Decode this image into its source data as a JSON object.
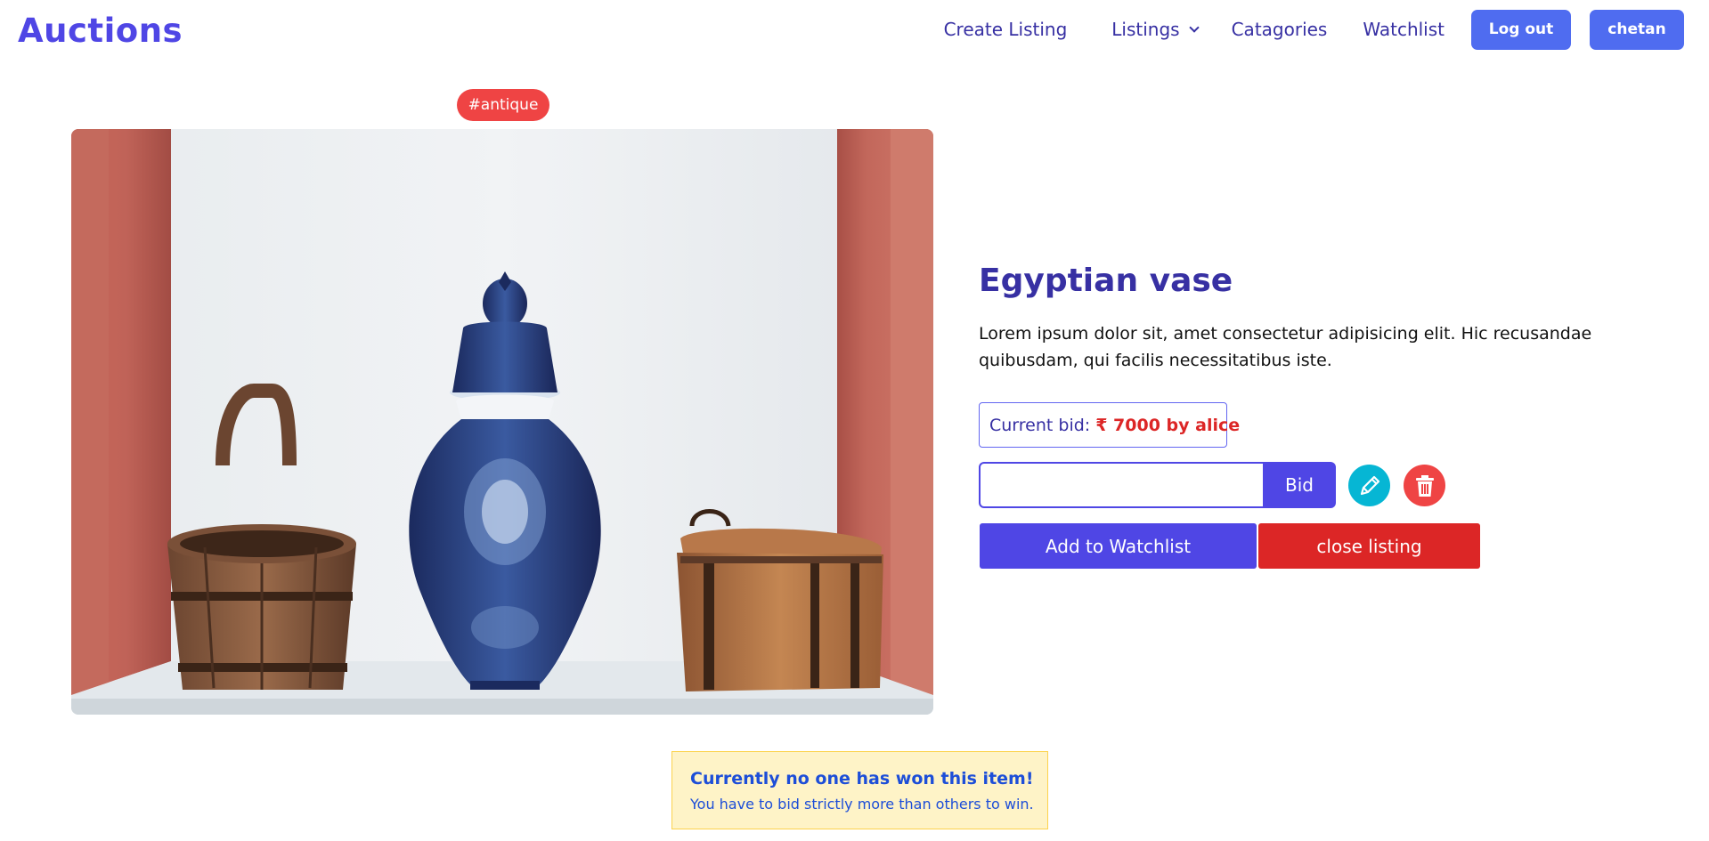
{
  "brand": "Auctions",
  "nav": {
    "create_listing": "Create Listing",
    "listings": "Listings",
    "categories": "Catagories",
    "watchlist": "Watchlist",
    "logout": "Log out",
    "user": "chetan"
  },
  "listing": {
    "tag": "#antique",
    "title": "Egyptian vase",
    "description": "Lorem ipsum dolor sit, amet consectetur adipisicing elit. Hic recusandae quibusdam, qui facilis necessitatibus iste.",
    "current_bid_label": "Current bid:",
    "current_bid_value": "₹ 7000 by alice",
    "bid_input_value": "",
    "bid_button": "Bid",
    "watchlist_button": "Add to Watchlist",
    "close_button": "close listing"
  },
  "notice": {
    "title": "Currently no one has won this item!",
    "text": "You have to bid strictly more than others to win."
  },
  "icons": {
    "edit": "pencil-icon",
    "delete": "trash-icon",
    "dropdown": "chevron-down-icon"
  },
  "colors": {
    "brand": "#4f46e5",
    "primary_dark": "#3730a3",
    "danger": "#dc2626",
    "tag": "#ef4444",
    "edit": "#06b6d4",
    "notice_bg": "#fef3c7"
  }
}
